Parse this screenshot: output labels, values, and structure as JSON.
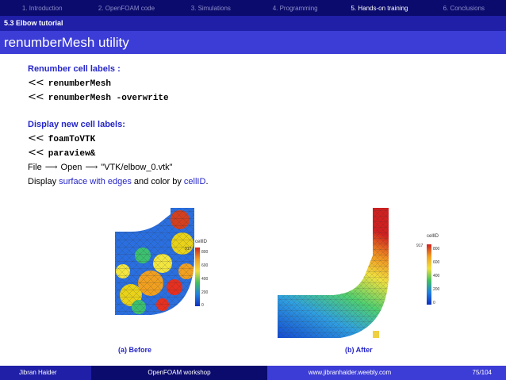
{
  "nav": {
    "items": [
      "1. Introduction",
      "2. OpenFOAM code",
      "3. Simulations",
      "4. Programming",
      "5. Hands-on training",
      "6. Conclusions"
    ],
    "active_index": 4
  },
  "subsection": "5.3 Elbow tutorial",
  "frame_title": "renumberMesh utility",
  "block1": {
    "title": "Renumber cell labels :",
    "cmds": [
      "renumberMesh",
      "renumberMesh -overwrite"
    ]
  },
  "block2": {
    "title": "Display new cell labels:",
    "cmds": [
      "foamToVTK",
      "paraview&"
    ],
    "file_line": {
      "file": "File",
      "open": "Open",
      "path": "\"VTK/elbow_0.vtk\""
    },
    "display_line": {
      "pre": "Display",
      "link1": "surface with edges",
      "mid": "and color by",
      "link2": "cellID",
      "post": "."
    }
  },
  "prompt_symbol": "<<",
  "arrow_symbol": "⟶",
  "figures": {
    "colorbar": {
      "title": "cellID",
      "max_label": "917",
      "ticks": [
        "800",
        "600",
        "400",
        "200",
        "0"
      ]
    },
    "caption_before": "(a) Before",
    "caption_after": "(b) After"
  },
  "footer": {
    "author": "Jibran Haider",
    "event": "OpenFOAM workshop",
    "website": "www.jibranhaider.weebly.com",
    "page": "75/104"
  },
  "colors": {
    "nav_bg": "#0b0b6e",
    "sub_bg": "#1f1fa8",
    "title_bg": "#3c3cd6",
    "accent": "#2626c8"
  }
}
